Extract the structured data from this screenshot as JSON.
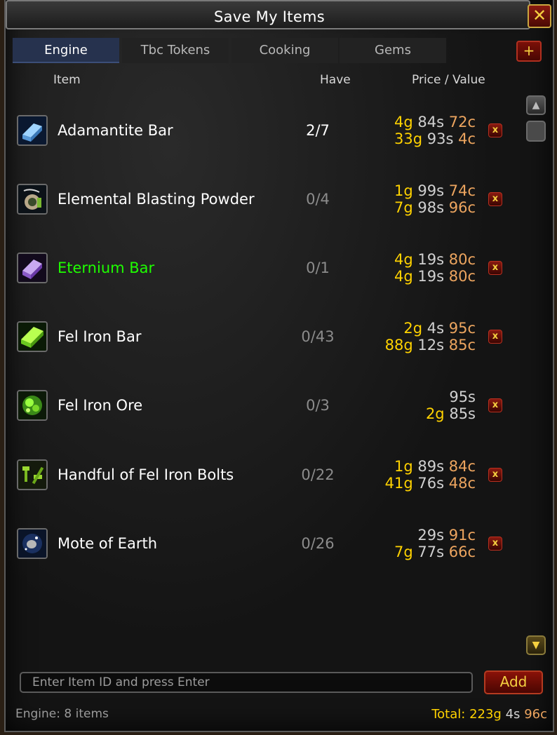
{
  "window": {
    "title": "Save My Items",
    "close_label": "✕"
  },
  "tabs": [
    {
      "label": "Engine",
      "active": true
    },
    {
      "label": "Tbc Tokens",
      "active": false
    },
    {
      "label": "Cooking",
      "active": false
    },
    {
      "label": "Gems",
      "active": false
    }
  ],
  "add_tab_label": "+",
  "columns": {
    "item": "Item",
    "have": "Have",
    "price": "Price / Value"
  },
  "items": [
    {
      "name": "Adamantite Bar",
      "icon": "adamantite-bar-icon",
      "have": "2/7",
      "price": {
        "g": "4g",
        "s": "84s",
        "c": "72c"
      },
      "value": {
        "g": "33g",
        "s": "93s",
        "c": "4c"
      }
    },
    {
      "name": "Elemental Blasting Powder",
      "icon": "blasting-powder-icon",
      "have": "0/4",
      "price": {
        "g": "1g",
        "s": "99s",
        "c": "74c"
      },
      "value": {
        "g": "7g",
        "s": "98s",
        "c": "96c"
      }
    },
    {
      "name": "Eternium Bar",
      "icon": "eternium-bar-icon",
      "have": "0/1",
      "price": {
        "g": "4g",
        "s": "19s",
        "c": "80c"
      },
      "value": {
        "g": "4g",
        "s": "19s",
        "c": "80c"
      }
    },
    {
      "name": "Fel Iron Bar",
      "icon": "fel-iron-bar-icon",
      "have": "0/43",
      "price": {
        "g": "2g",
        "s": "4s",
        "c": "95c"
      },
      "value": {
        "g": "88g",
        "s": "12s",
        "c": "85c"
      }
    },
    {
      "name": "Fel Iron Ore",
      "icon": "fel-iron-ore-icon",
      "have": "0/3",
      "price": {
        "g": "",
        "s": "95s",
        "c": ""
      },
      "value": {
        "g": "2g",
        "s": "85s",
        "c": ""
      }
    },
    {
      "name": "Handful of Fel Iron Bolts",
      "icon": "fel-iron-bolts-icon",
      "have": "0/22",
      "price": {
        "g": "1g",
        "s": "89s",
        "c": "84c"
      },
      "value": {
        "g": "41g",
        "s": "76s",
        "c": "48c"
      }
    },
    {
      "name": "Mote of Earth",
      "icon": "mote-of-earth-icon",
      "have": "0/26",
      "price": {
        "g": "",
        "s": "29s",
        "c": "91c"
      },
      "value": {
        "g": "7g",
        "s": "77s",
        "c": "66c"
      }
    }
  ],
  "remove_label": "x",
  "input": {
    "placeholder": "Enter Item ID and press Enter",
    "value": ""
  },
  "add_button_label": "Add",
  "status": "Engine: 8 items",
  "total": {
    "label": "Total:",
    "g": "223g",
    "s": "4s",
    "c": "96c"
  },
  "colors": {
    "gold": "#ffd200",
    "silver": "#d0d0d0",
    "copper": "#eda55f",
    "uncommon": "#1eff00",
    "tab_active": "#26324e"
  }
}
